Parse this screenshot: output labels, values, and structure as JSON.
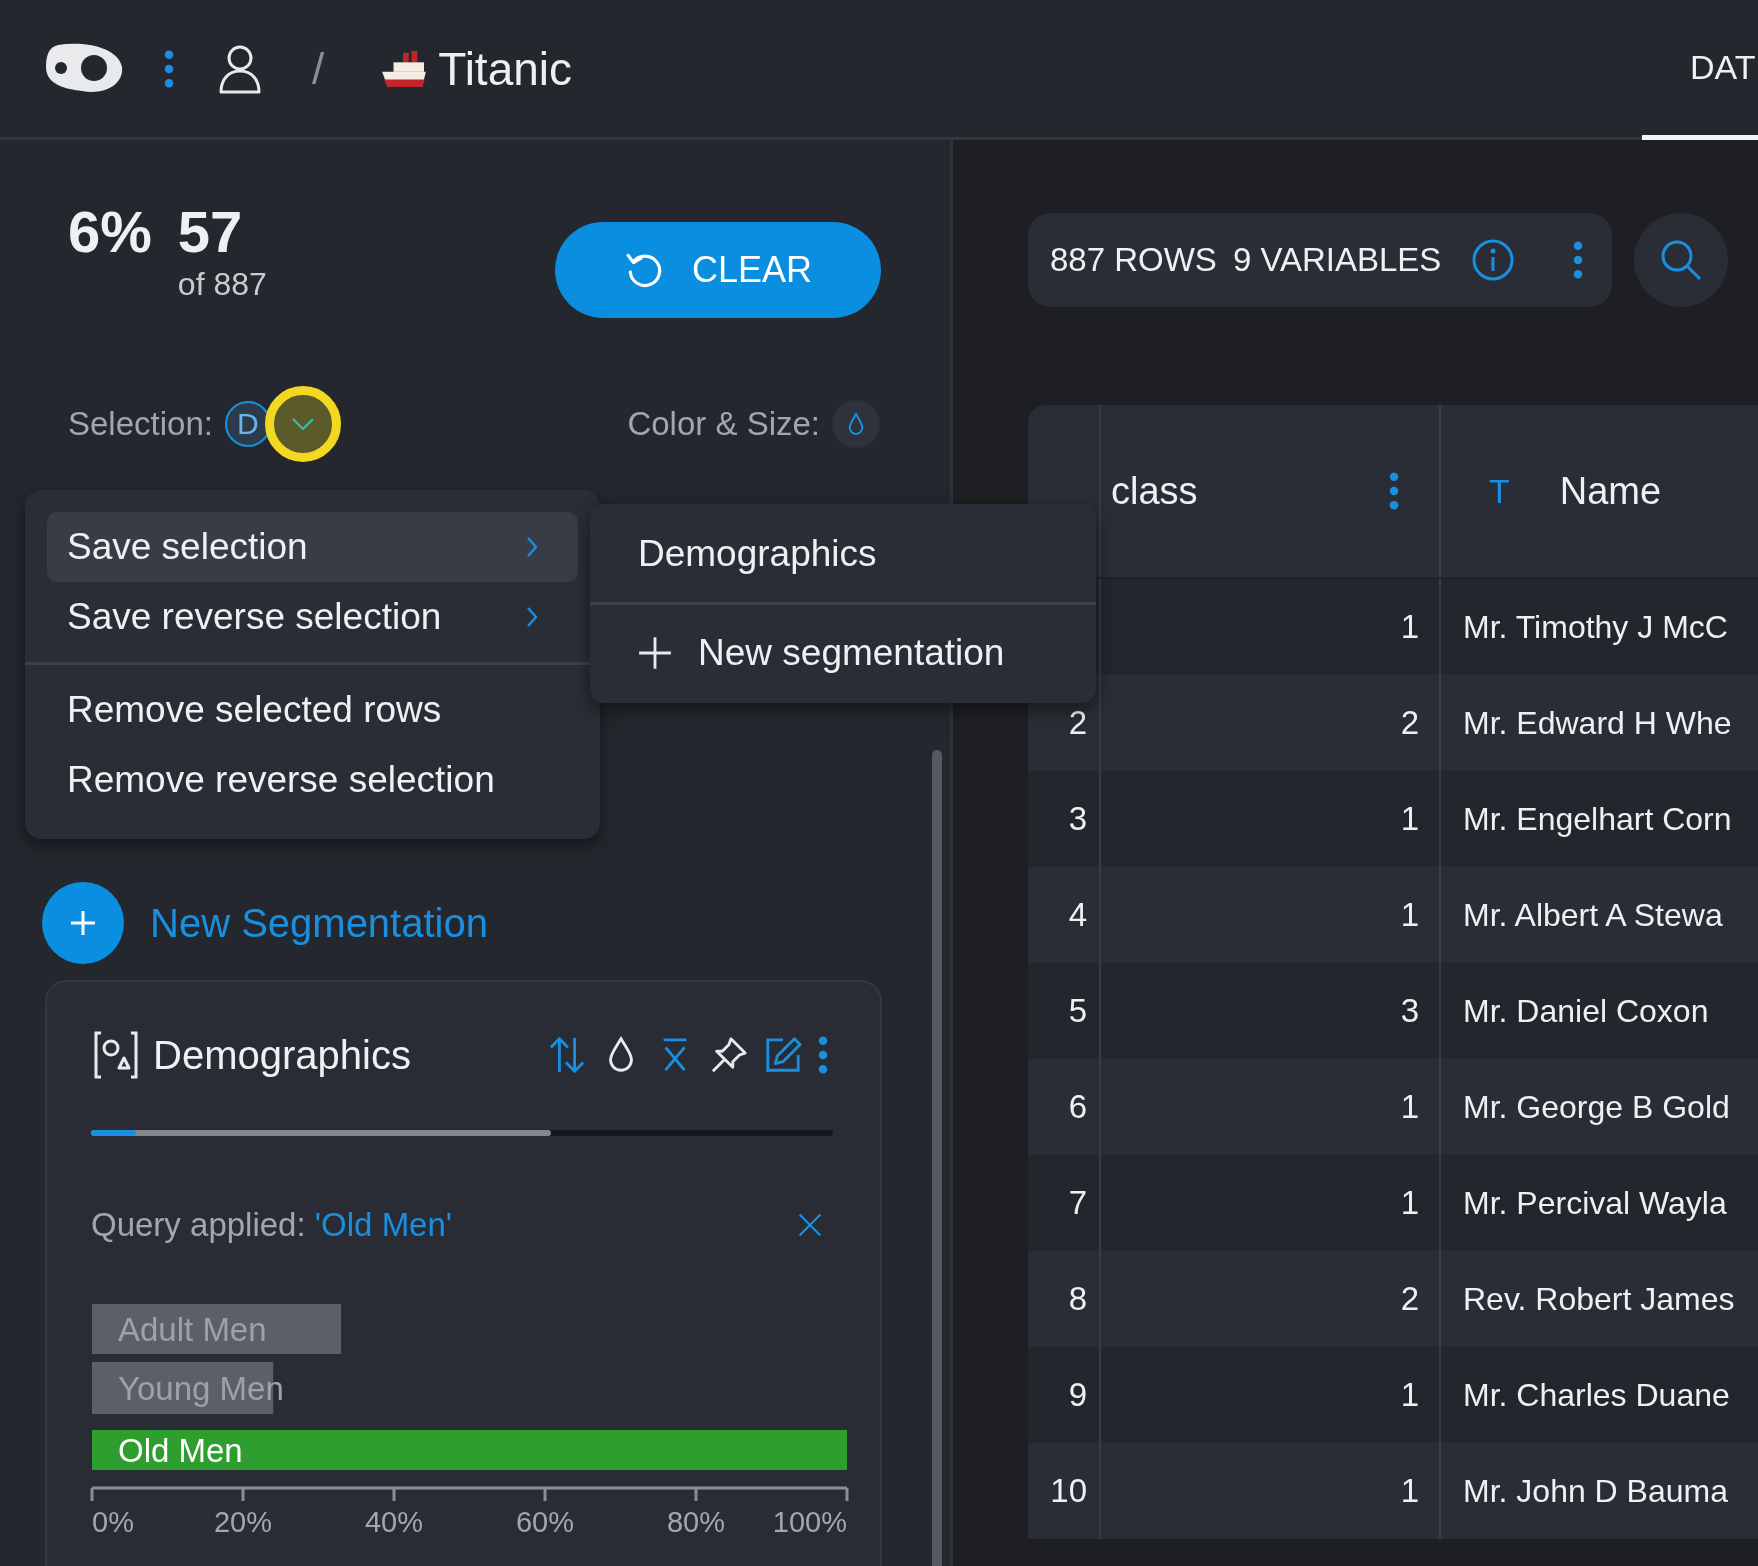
{
  "header": {
    "separator": "/",
    "dataset": "Titanic",
    "tabs": [
      {
        "label": "DAT",
        "selected": true
      }
    ]
  },
  "summary": {
    "percent": "6%",
    "count": "57",
    "total": "of 887",
    "clear_button": "CLEAR"
  },
  "selection": {
    "label": "Selection:",
    "badge": "D",
    "menu_open": true
  },
  "color_size": {
    "label": "Color & Size:"
  },
  "selection_menu": {
    "groups": [
      [
        {
          "label": "Save selection",
          "selected": true,
          "has_submenu": true
        },
        {
          "label": "Save reverse selection",
          "selected": false,
          "has_submenu": true
        }
      ],
      [
        {
          "label": "Remove selected rows",
          "selected": false,
          "has_submenu": false
        },
        {
          "label": "Remove reverse selection",
          "selected": false,
          "has_submenu": false
        }
      ]
    ]
  },
  "submenu": {
    "items": [
      {
        "kind": "segmentation",
        "label": "Demographics"
      },
      {
        "kind": "new",
        "label": "New segmentation"
      }
    ]
  },
  "new_segmentation_button": "New Segmentation",
  "segmentation_card": {
    "title": "Demographics",
    "coverage": [
      {
        "kind": "query",
        "level": 0.62
      },
      {
        "kind": "selection",
        "level": 0.06
      }
    ],
    "query_label": "Query applied:",
    "query_value": "'Old Men'",
    "chart_data": {
      "type": "bar",
      "orientation": "horizontal",
      "categories": [
        "Adult Men",
        "Young Men",
        "Old Men"
      ],
      "series": [
        {
          "color": "#5b5f67",
          "values": [
            33,
            24,
            null
          ]
        },
        {
          "color": "#2e9e2e",
          "values": [
            null,
            null,
            100
          ]
        }
      ],
      "xlim": [
        0,
        100
      ],
      "xticks": [
        {
          "value": 0,
          "label": "0%"
        },
        {
          "value": 20,
          "label": "20%"
        },
        {
          "value": 40,
          "label": "40%"
        },
        {
          "value": 60,
          "label": "60%"
        },
        {
          "value": 80,
          "label": "80%"
        },
        {
          "value": 100,
          "label": "100%"
        }
      ]
    }
  },
  "dataset_info": {
    "rows": "887 ROWS",
    "variables": "9 VARIABLES"
  },
  "table": {
    "columns": [
      {
        "label": "class",
        "kebab": true
      },
      {
        "type_glyph": "T",
        "label": "Name",
        "kebab": false
      }
    ],
    "rows": [
      {
        "pclass": "1",
        "name": "Mr. Timothy J McC"
      },
      {
        "index": "2",
        "pclass": "2",
        "name": "Mr. Edward H Whe"
      },
      {
        "index": "3",
        "pclass": "1",
        "name": "Mr. Engelhart Corn"
      },
      {
        "index": "4",
        "pclass": "1",
        "name": "Mr. Albert A Stewa"
      },
      {
        "index": "5",
        "pclass": "3",
        "name": "Mr. Daniel Coxon"
      },
      {
        "index": "6",
        "pclass": "1",
        "name": "Mr. George B Gold"
      },
      {
        "index": "7",
        "pclass": "1",
        "name": "Mr. Percival Wayla"
      },
      {
        "index": "8",
        "pclass": "2",
        "name": "Rev. Robert James"
      },
      {
        "index": "9",
        "pclass": "1",
        "name": "Mr. Charles Duane"
      },
      {
        "index": "10",
        "pclass": "1",
        "name": "Mr. John D Bauma"
      }
    ]
  }
}
